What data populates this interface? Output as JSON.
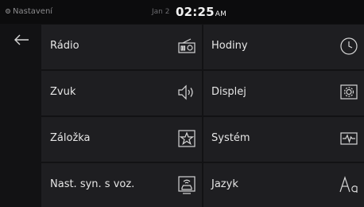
{
  "status": {
    "app_title": "Nastavení",
    "date": "Jan 2",
    "time": "02:25",
    "ampm": "AM"
  },
  "menu": {
    "items": [
      {
        "label": "Rádio",
        "icon": "radio-icon"
      },
      {
        "label": "Hodiny",
        "icon": "clock-icon"
      },
      {
        "label": "Zvuk",
        "icon": "speaker-icon"
      },
      {
        "label": "Displej",
        "icon": "display-icon"
      },
      {
        "label": "Záložka",
        "icon": "star-icon"
      },
      {
        "label": "Systém",
        "icon": "system-icon"
      },
      {
        "label": "Nast. syn. s voz.",
        "icon": "car-sync-icon"
      },
      {
        "label": "Jazyk",
        "icon": "language-icon"
      }
    ]
  }
}
